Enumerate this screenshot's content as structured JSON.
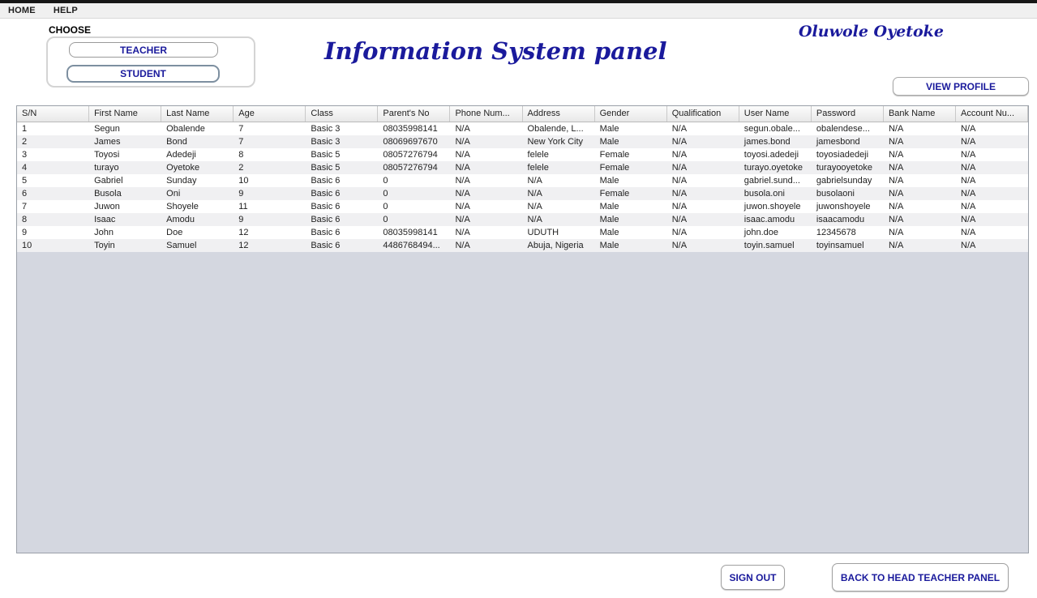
{
  "menu": {
    "items": [
      {
        "label": "HOME"
      },
      {
        "label": "HELP"
      }
    ]
  },
  "choose": {
    "label": "CHOOSE",
    "teacher_button": "TEACHER",
    "student_button": "STUDENT"
  },
  "header": {
    "title": "Information System panel",
    "user_name": "Oluwole Oyetoke",
    "view_profile_button": "VIEW PROFILE"
  },
  "table": {
    "columns": [
      "S/N",
      "First Name",
      "Last Name",
      "Age",
      "Class",
      "Parent's No",
      "Phone Num...",
      "Address",
      "Gender",
      "Qualification",
      "User Name",
      "Password",
      "Bank Name",
      "Account Nu..."
    ],
    "rows": [
      [
        "1",
        "Segun",
        "Obalende",
        "7",
        "Basic 3",
        "08035998141",
        "N/A",
        "Obalende, L...",
        "Male",
        "N/A",
        "segun.obale...",
        "obalendese...",
        "N/A",
        "N/A"
      ],
      [
        "2",
        "James",
        "Bond",
        "7",
        "Basic 3",
        "08069697670",
        "N/A",
        "New York City",
        "Male",
        "N/A",
        "james.bond",
        "jamesbond",
        "N/A",
        "N/A"
      ],
      [
        "3",
        "Toyosi",
        "Adedeji",
        "8",
        "Basic 5",
        "08057276794",
        "N/A",
        "felele",
        "Female",
        "N/A",
        "toyosi.adedeji",
        "toyosiadedeji",
        "N/A",
        "N/A"
      ],
      [
        "4",
        "turayo",
        "Oyetoke",
        "2",
        "Basic 5",
        "08057276794",
        "N/A",
        "felele",
        "Female",
        "N/A",
        "turayo.oyetoke",
        "turayooyetoke",
        "N/A",
        "N/A"
      ],
      [
        "5",
        "Gabriel",
        "Sunday",
        "10",
        "Basic 6",
        "0",
        "N/A",
        "N/A",
        "Male",
        "N/A",
        "gabriel.sund...",
        "gabrielsunday",
        "N/A",
        "N/A"
      ],
      [
        "6",
        "Busola",
        "Oni",
        "9",
        "Basic 6",
        "0",
        "N/A",
        "N/A",
        "Female",
        "N/A",
        "busola.oni",
        "busolaoni",
        "N/A",
        "N/A"
      ],
      [
        "7",
        "Juwon",
        "Shoyele",
        "11",
        "Basic 6",
        "0",
        "N/A",
        "N/A",
        "Male",
        "N/A",
        "juwon.shoyele",
        "juwonshoyele",
        "N/A",
        "N/A"
      ],
      [
        "8",
        "Isaac",
        "Amodu",
        "9",
        "Basic 6",
        "0",
        "N/A",
        "N/A",
        "Male",
        "N/A",
        "isaac.amodu",
        "isaacamodu",
        "N/A",
        "N/A"
      ],
      [
        "9",
        "John",
        "Doe",
        "12",
        "Basic 6",
        "08035998141",
        "N/A",
        "UDUTH",
        "Male",
        "N/A",
        "john.doe",
        "12345678",
        "N/A",
        "N/A"
      ],
      [
        "10",
        "Toyin",
        "Samuel",
        "12",
        "Basic 6",
        "4486768494...",
        "N/A",
        "Abuja, Nigeria",
        "Male",
        "N/A",
        "toyin.samuel",
        "toyinsamuel",
        "N/A",
        "N/A"
      ]
    ]
  },
  "footer": {
    "sign_out_button": "SIGN OUT",
    "back_button": "BACK TO HEAD TEACHER PANEL"
  },
  "colors": {
    "accent_navy": "#1a1a9c",
    "table_empty_area": "#d4d7e0",
    "row_alt": "#f0f0f2",
    "menubar_bg": "#f0f0f0"
  }
}
